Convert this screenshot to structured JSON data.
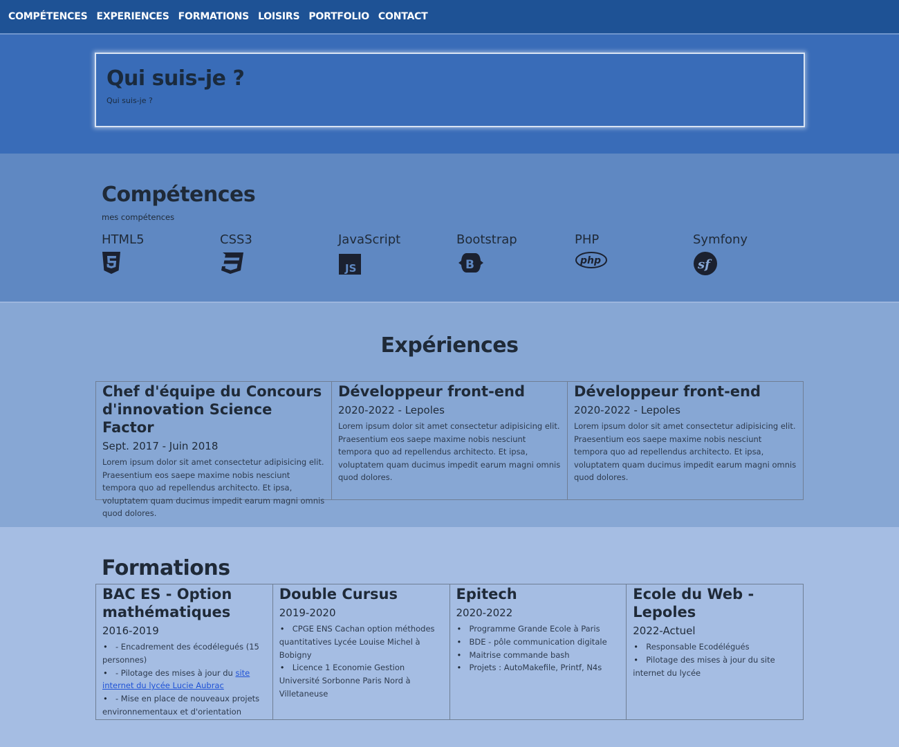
{
  "nav": [
    "COMPÉTENCES",
    "EXPERIENCES",
    "FORMATIONS",
    "LOISIRS",
    "PORTFOLIO",
    "CONTACT"
  ],
  "hero": {
    "title": "Qui suis-je ?",
    "subtitle": "Qui suis-je ?"
  },
  "skills": {
    "title": "Compétences",
    "subtitle": "mes compétences",
    "items": [
      {
        "name": "HTML5",
        "icon": "html5-icon"
      },
      {
        "name": "CSS3",
        "icon": "css3-icon"
      },
      {
        "name": "JavaScript",
        "icon": "javascript-icon"
      },
      {
        "name": "Bootstrap",
        "icon": "bootstrap-icon"
      },
      {
        "name": "PHP",
        "icon": "php-icon"
      },
      {
        "name": "Symfony",
        "icon": "symfony-icon"
      }
    ]
  },
  "experiences": {
    "title": "Expériences",
    "items": [
      {
        "title": "Chef d'équipe du Concours d'innovation Science Factor",
        "date": "Sept. 2017 - Juin 2018",
        "text": "Lorem ipsum dolor sit amet consectetur adipisicing elit. Praesentium eos saepe maxime nobis nesciunt tempora quo ad repellendus architecto. Et ipsa, voluptatem quam ducimus impedit earum magni omnis quod dolores."
      },
      {
        "title": "Développeur front-end",
        "date": "2020-2022 - Lepoles",
        "text": "Lorem ipsum dolor sit amet consectetur adipisicing elit. Praesentium eos saepe maxime nobis nesciunt tempora quo ad repellendus architecto. Et ipsa, voluptatem quam ducimus impedit earum magni omnis quod dolores."
      },
      {
        "title": "Développeur front-end",
        "date": "2020-2022 - Lepoles",
        "text": "Lorem ipsum dolor sit amet consectetur adipisicing elit. Praesentium eos saepe maxime nobis nesciunt tempora quo ad repellendus architecto. Et ipsa, voluptatem quam ducimus impedit earum magni omnis quod dolores."
      }
    ]
  },
  "formations": {
    "title": "Formations",
    "items": [
      {
        "title": "BAC ES - Option mathématiques",
        "date": "2016-2019",
        "bullets": [
          "- Encadrement des écodélegués (15 personnes)",
          "- Pilotage des mises à jour du ",
          "- Mise en place de nouveaux projets environnementaux et d'orientation"
        ],
        "link": "site internet du lycée Lucie Aubrac"
      },
      {
        "title": "Double Cursus",
        "date": "2019-2020",
        "bullets": [
          "CPGE ENS Cachan option méthodes quantitatives Lycée Louise Michel à Bobigny",
          "Licence 1 Economie Gestion Université Sorbonne Paris Nord à Villetaneuse"
        ]
      },
      {
        "title": "Epitech",
        "date": "2020-2022",
        "bullets": [
          "Programme Grande Ecole à Paris",
          "BDE - pôle communication digitale",
          "Maitrise commande bash",
          "Projets : AutoMakefile, Printf, N4s"
        ]
      },
      {
        "title": "Ecole du Web - Lepoles",
        "date": "2022-Actuel",
        "bullets": [
          "Responsable Ecodélégués",
          "Pilotage des mises à jour du site internet du lycée"
        ]
      }
    ]
  }
}
